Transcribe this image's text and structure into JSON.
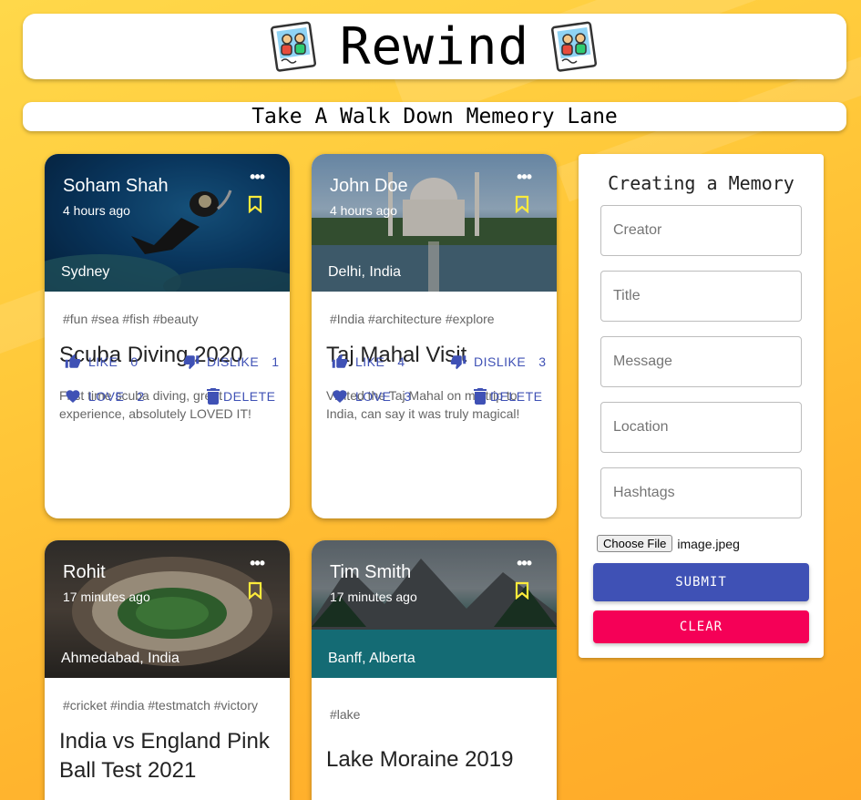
{
  "app": {
    "title": "Rewind",
    "subtitle": "Take A Walk Down Memeory Lane"
  },
  "posts": [
    {
      "creator": "Soham Shah",
      "time": "4 hours ago",
      "location": "Sydney",
      "tags": "#fun #sea #fish #beauty",
      "title": "Scuba Diving 2020",
      "message": "First time scuba diving, great experience, absolutely LOVED IT!",
      "like_label": "LIKE",
      "like_count": "0",
      "dislike_label": "DISLIKE",
      "dislike_count": "1",
      "love_label": "LOVE",
      "love_count": "2",
      "delete_label": "DELETE",
      "more_icon": "more-horiz-icon"
    },
    {
      "creator": "John Doe",
      "time": "4 hours ago",
      "location": "Delhi, India",
      "tags": "#India #architecture #explore",
      "title": "Taj Mahal Visit",
      "message": "Visited the Taj Mahal on my trip to India, can say it was truly magical!",
      "like_label": "LIKE",
      "like_count": "4",
      "dislike_label": "DISLIKE",
      "dislike_count": "3",
      "love_label": "LOVE",
      "love_count": "3",
      "delete_label": "DELETE",
      "more_icon": "more-horiz-icon"
    },
    {
      "creator": "Rohit",
      "time": "17 minutes ago",
      "location": "Ahmedabad, India",
      "tags": "#cricket #india #testmatch #victory",
      "title": "India vs England Pink Ball Test 2021",
      "more_icon": "more-horiz-icon"
    },
    {
      "creator": "Tim Smith",
      "time": "17 minutes ago",
      "location": "Banff, Alberta",
      "tags": "#lake",
      "title": "Lake Moraine 2019",
      "more_icon": "more-horiz-icon"
    }
  ],
  "form": {
    "heading": "Creating a Memory",
    "creator_placeholder": "Creator",
    "title_placeholder": "Title",
    "message_placeholder": "Message",
    "location_placeholder": "Location",
    "hashtags_placeholder": "Hashtags",
    "file_button": "Choose File",
    "file_name": "image.jpeg",
    "submit_label": "SUBMIT",
    "clear_label": "CLEAR"
  },
  "colors": {
    "primary": "#3f51b5",
    "secondary": "#f50057",
    "bookmark": "#ffeb3b",
    "background": "#ffc93a"
  }
}
